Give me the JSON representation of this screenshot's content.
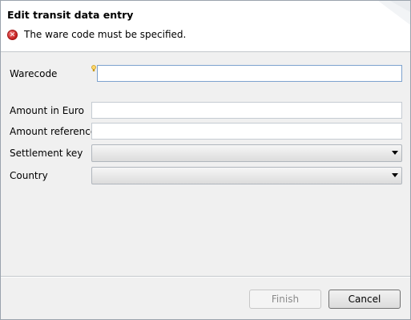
{
  "dialog": {
    "title": "Edit transit data entry",
    "message": "The ware code must be specified.",
    "message_icon": "error-icon"
  },
  "form": {
    "warecode": {
      "label": "Warecode",
      "value": "",
      "decoration_icon": "lightbulb-icon"
    },
    "amount_euro": {
      "label": "Amount in Euro",
      "value": ""
    },
    "amount_reference": {
      "label": "Amount reference",
      "value": ""
    },
    "settlement_key": {
      "label": "Settlement key",
      "value": ""
    },
    "country": {
      "label": "Country",
      "value": ""
    }
  },
  "buttons": {
    "finish": "Finish",
    "cancel": "Cancel"
  },
  "colors": {
    "error": "#c41e1e",
    "focus_border": "#7da2ce"
  }
}
